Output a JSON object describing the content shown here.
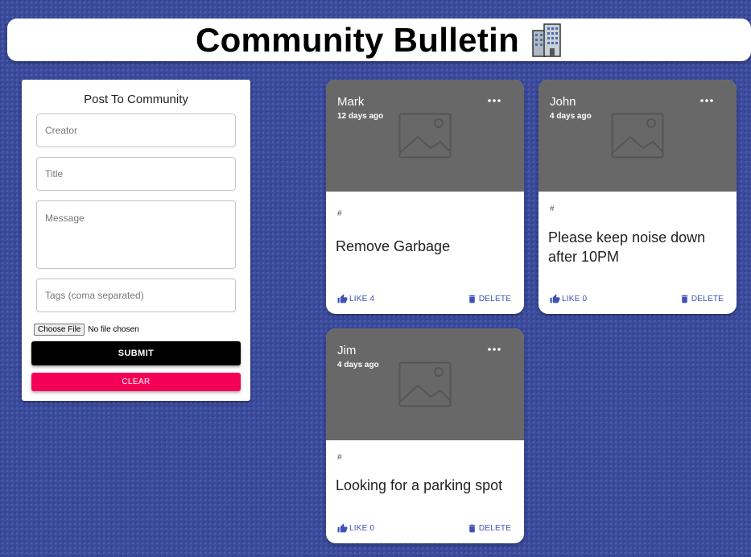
{
  "header": {
    "title": "Community Bulletin",
    "icon": "office-building-icon"
  },
  "form": {
    "title": "Post To Community",
    "creator_placeholder": "Creator",
    "title_placeholder": "Title",
    "message_placeholder": "Message",
    "tags_placeholder": "Tags (coma separated)",
    "file_button": "Choose File",
    "file_status": "No file chosen",
    "submit_label": "SUBMIT",
    "clear_label": "CLEAR"
  },
  "posts": [
    {
      "creator": "Mark",
      "time": "12 days ago",
      "tags": "#",
      "title": "Remove Garbage",
      "like_label": "LIKE 4",
      "delete_label": "DELETE"
    },
    {
      "creator": "John",
      "time": "4 days ago",
      "tags": "#",
      "title": "Please keep noise down after 10PM",
      "like_label": "LIKE 0",
      "delete_label": "DELETE"
    },
    {
      "creator": "Jim",
      "time": "4 days ago",
      "tags": "#",
      "title": "Looking for a parking spot",
      "like_label": "LIKE 0",
      "delete_label": "DELETE"
    }
  ],
  "colors": {
    "background": "#3a4a9c",
    "primary": "#3f51b5",
    "secondary": "#f50057",
    "media": "#686868"
  }
}
